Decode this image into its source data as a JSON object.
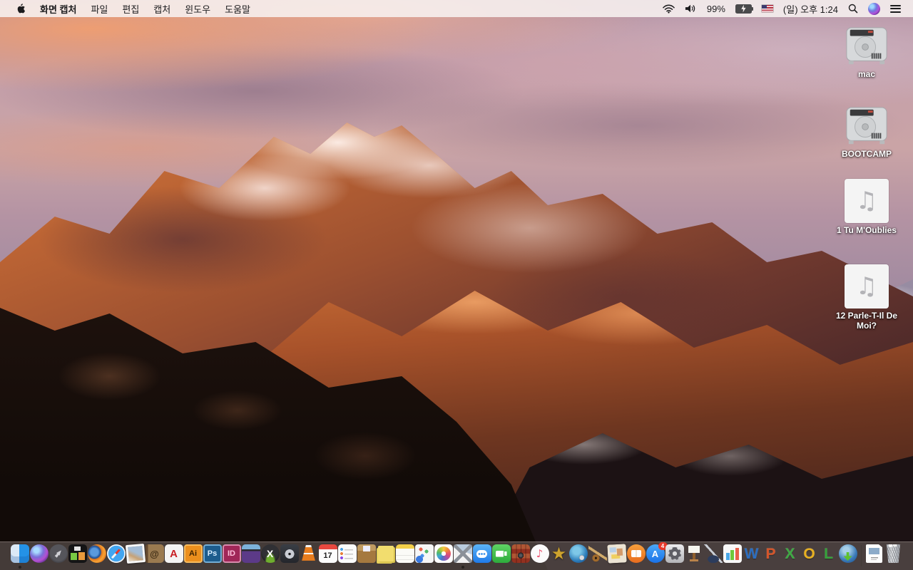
{
  "menubar": {
    "app_name": "화면 캡처",
    "menus": [
      "파일",
      "편집",
      "캡처",
      "윈도우",
      "도움말"
    ],
    "status": {
      "battery_percent": "99%",
      "clock": "(일) 오후 1:24"
    }
  },
  "desktop": {
    "icons": [
      {
        "type": "drive",
        "label": "mac"
      },
      {
        "type": "drive",
        "label": "BOOTCAMP"
      },
      {
        "type": "music",
        "label": "1 Tu M'Oublies",
        "glyph": "♫"
      },
      {
        "type": "music",
        "label": "12 Parle-T-Il De Moi?",
        "glyph": "♫"
      }
    ]
  },
  "dock": {
    "items": [
      {
        "id": "finder",
        "label": "Finder",
        "running": true
      },
      {
        "id": "siri",
        "label": "Siri"
      },
      {
        "id": "launchpad",
        "label": "Launchpad"
      },
      {
        "id": "mission-control",
        "label": "Mission Control"
      },
      {
        "id": "firefox",
        "label": "Firefox"
      },
      {
        "id": "safari",
        "label": "Safari"
      },
      {
        "id": "preview",
        "label": "Preview"
      },
      {
        "id": "contacts",
        "label": "Contacts",
        "glyph": "@",
        "glyph_color": "#402e16"
      },
      {
        "id": "acrobat",
        "label": "Adobe Acrobat Reader",
        "glyph": "A",
        "glyph_color": "#c81f25"
      },
      {
        "id": "illustrator",
        "label": "Adobe Illustrator",
        "glyph": "Ai",
        "glyph_color": "#3f2300"
      },
      {
        "id": "photoshop",
        "label": "Adobe Photoshop",
        "glyph": "Ps",
        "glyph_color": "#d6ecff"
      },
      {
        "id": "indesign",
        "label": "Adobe InDesign",
        "glyph": "ID",
        "glyph_color": "#ffc0dc"
      },
      {
        "id": "toast",
        "label": "Toast Titanium"
      },
      {
        "id": "xld",
        "label": "Media Converter",
        "glyph": "X",
        "glyph_color": "#ffffff"
      },
      {
        "id": "disk-tool",
        "label": "Disk Utility"
      },
      {
        "id": "vlc",
        "label": "VLC"
      },
      {
        "id": "calendar",
        "label": "Calendar",
        "glyph": "17",
        "glyph_color": "#222222"
      },
      {
        "id": "reminders",
        "label": "Reminders"
      },
      {
        "id": "unarchiver",
        "label": "Archive Utility"
      },
      {
        "id": "stickies",
        "label": "Stickies"
      },
      {
        "id": "notes",
        "label": "Notes"
      },
      {
        "id": "doc-reader",
        "label": "Documents App"
      },
      {
        "id": "photos",
        "label": "Photos"
      },
      {
        "id": "grab",
        "label": "화면 캡처",
        "running": true
      },
      {
        "id": "messages",
        "label": "Messages"
      },
      {
        "id": "facetime",
        "label": "FaceTime"
      },
      {
        "id": "photo-booth",
        "label": "Photo Booth"
      },
      {
        "id": "itunes",
        "label": "iTunes",
        "glyph": "♪",
        "glyph_color": "#ef5e78"
      },
      {
        "id": "imovie",
        "label": "iMovie",
        "glyph": "★",
        "glyph_color": "#cda32e"
      },
      {
        "id": "media-player",
        "label": "Media Player"
      },
      {
        "id": "garageband",
        "label": "GarageBand"
      },
      {
        "id": "collage",
        "label": "Collage Documents App"
      },
      {
        "id": "ibooks",
        "label": "iBooks"
      },
      {
        "id": "app-store",
        "label": "App Store",
        "glyph": "A",
        "glyph_color": "#ffffff",
        "badge": "4"
      },
      {
        "id": "sys-prefs",
        "label": "System Preferences"
      },
      {
        "id": "keynote",
        "label": "Keynote"
      },
      {
        "id": "pages",
        "label": "Pages"
      },
      {
        "id": "numbers",
        "label": "Numbers"
      },
      {
        "id": "word",
        "label": "Microsoft Word",
        "glyph": "W",
        "glyph_color": "#2b6dbf"
      },
      {
        "id": "powerpoint",
        "label": "Microsoft PowerPoint",
        "glyph": "P",
        "glyph_color": "#d4552a"
      },
      {
        "id": "excel",
        "label": "Microsoft Excel",
        "glyph": "X",
        "glyph_color": "#3faa44"
      },
      {
        "id": "outlook",
        "label": "Microsoft Outlook",
        "glyph": "O",
        "glyph_color": "#e8b020"
      },
      {
        "id": "lync",
        "label": "Microsoft Lync",
        "glyph": "L",
        "glyph_color": "#35a23a"
      },
      {
        "id": "downloader",
        "label": "Download Manager"
      },
      {
        "id": "divider",
        "type": "divider"
      },
      {
        "id": "document",
        "label": "Document File"
      },
      {
        "id": "trash",
        "label": "Trash"
      }
    ]
  }
}
